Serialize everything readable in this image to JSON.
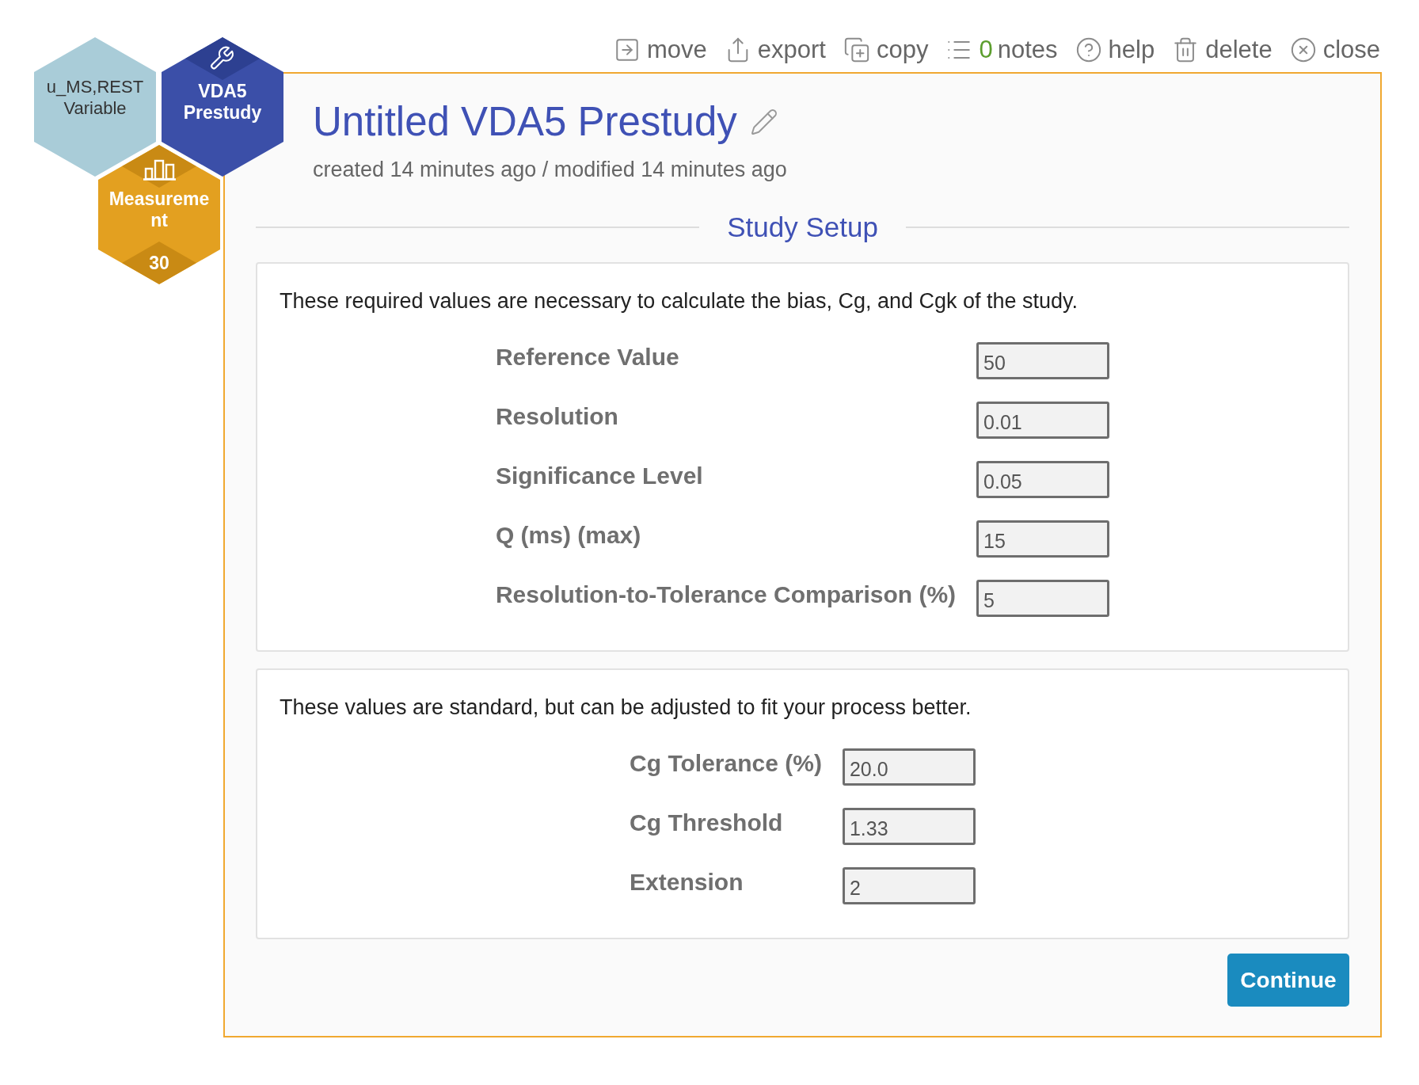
{
  "node_map": [
    {
      "kind": "variable",
      "label": "u_MS,REST Variable"
    },
    {
      "kind": "study",
      "label": "VDA5 Prestudy"
    },
    {
      "kind": "measurement",
      "label": "Measurement",
      "count": "30"
    }
  ],
  "toolbar": [
    {
      "kind": "move",
      "label": "move"
    },
    {
      "kind": "export",
      "label": "export"
    },
    {
      "kind": "copy",
      "label": "copy"
    },
    {
      "kind": "notes",
      "count": "0",
      "label": "notes"
    },
    {
      "kind": "help",
      "label": "help"
    },
    {
      "kind": "delete",
      "label": "delete"
    },
    {
      "kind": "close",
      "label": "close"
    }
  ],
  "study": {
    "title": "Untitled VDA5 Prestudy",
    "timestamps": "created 14 minutes ago / modified 14 minutes ago",
    "section_title": "Study Setup"
  },
  "sections": [
    {
      "intro": "These required values are necessary to calculate the bias, Cg, and Cgk of the study.",
      "fields": [
        {
          "label": "Reference Value",
          "value": "50"
        },
        {
          "label": "Resolution",
          "value": "0.01"
        },
        {
          "label": "Significance Level",
          "value": "0.05"
        },
        {
          "label": "Q (ms) (max)",
          "value": "15"
        },
        {
          "label": "Resolution-to-Tolerance Comparison (%)",
          "value": "5"
        }
      ]
    },
    {
      "intro": "These values are standard, but can be adjusted to fit your process better.",
      "fields": [
        {
          "label": "Cg Tolerance (%)",
          "value": "20.0"
        },
        {
          "label": "Cg Threshold",
          "value": "1.33"
        },
        {
          "label": "Extension",
          "value": "2"
        }
      ]
    }
  ],
  "continue_button": "Continue"
}
